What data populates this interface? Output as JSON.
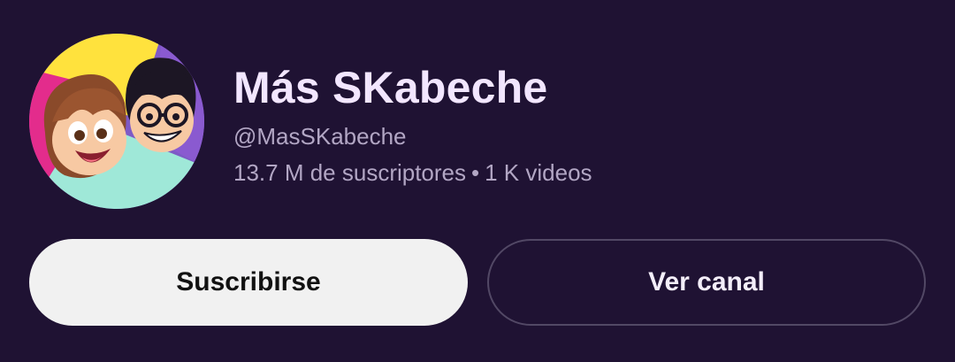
{
  "channel": {
    "name": "Más SKabeche",
    "handle": "@MasSKabeche",
    "subscribers": "13.7 M de suscriptores",
    "separator": "•",
    "videos": "1 K videos",
    "avatar_icon": "cartoon-duo-avatar"
  },
  "actions": {
    "subscribe_label": "Suscribirse",
    "view_channel_label": "Ver canal"
  },
  "colors": {
    "background": "#1f1233",
    "subscribe_bg": "#f1f1f1",
    "title_text": "#f2e6ff",
    "secondary_text": "#b2a6c4",
    "outline": "#524865"
  }
}
